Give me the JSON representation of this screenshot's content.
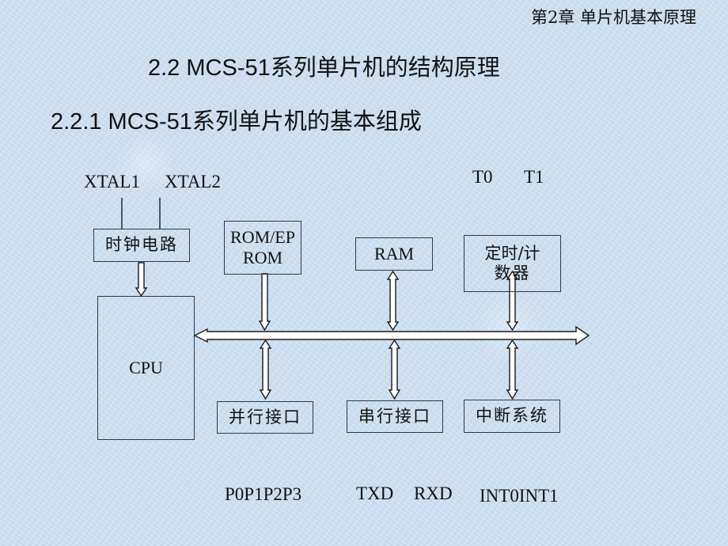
{
  "header": {
    "chapter": "第2章  单片机基本原理"
  },
  "titles": {
    "section": "2.2 MCS-51系列单片机的结构原理",
    "subsection": "2.2.1 MCS-51系列单片机的基本组成"
  },
  "diagram": {
    "pin_labels": {
      "xtal1": "XTAL1",
      "xtal2": "XTAL2",
      "t0": "T0",
      "t1": "T1",
      "ports": "P0P1P2P3",
      "txd": "TXD",
      "rxd": "RXD",
      "interrupts": "INT0INT1"
    },
    "blocks": {
      "clock": "时钟电路",
      "cpu": "CPU",
      "rom_line1": "ROM/EP",
      "rom_line2": "ROM",
      "ram": "RAM",
      "timer_line1": "定时/计",
      "timer_line2": "数器",
      "parallel": "并行接口",
      "serial": "串行接口",
      "interrupt": "中断系统"
    },
    "connections": [
      {
        "from": "XTAL1",
        "to": "时钟电路",
        "type": "line"
      },
      {
        "from": "XTAL2",
        "to": "时钟电路",
        "type": "line"
      },
      {
        "from": "时钟电路",
        "to": "CPU",
        "type": "one-way"
      },
      {
        "from": "ROM/EPROM",
        "to": "bus",
        "type": "one-way"
      },
      {
        "from": "RAM",
        "to": "bus",
        "type": "two-way"
      },
      {
        "from": "定时/计数器",
        "to": "bus",
        "type": "two-way"
      },
      {
        "from": "bus",
        "to": "并行接口",
        "type": "two-way"
      },
      {
        "from": "bus",
        "to": "串行接口",
        "type": "two-way"
      },
      {
        "from": "bus",
        "to": "中断系统",
        "type": "two-way"
      },
      {
        "from": "bus",
        "to": "CPU",
        "type": "two-way"
      }
    ]
  },
  "colors": {
    "background": "#cfe0f0",
    "stroke": "#1a1a1a",
    "arrow_fill": "#ffffff"
  }
}
